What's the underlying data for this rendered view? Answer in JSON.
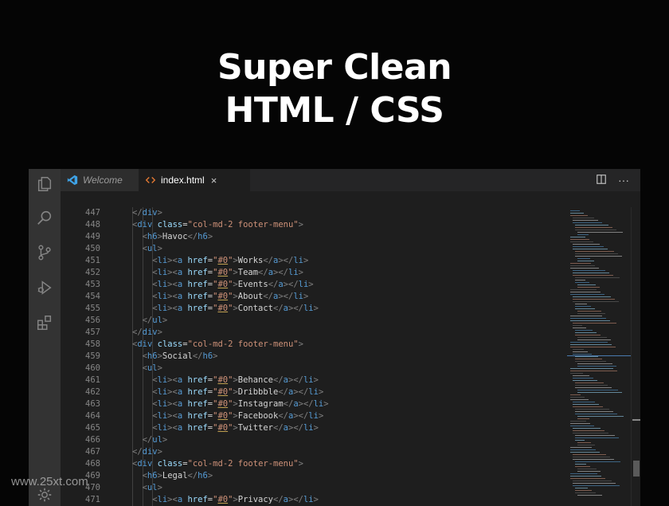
{
  "headline": {
    "line1": "Super Clean",
    "line2": "HTML / CSS"
  },
  "tabs": [
    {
      "label": "Welcome",
      "icon": "vscode-logo-icon",
      "active": false
    },
    {
      "label": "index.html",
      "icon": "html-file-icon",
      "active": true,
      "close": "×"
    }
  ],
  "tab_actions": {
    "split": "split-editor-icon",
    "more": "···"
  },
  "activity_bar": [
    "explorer-icon",
    "search-icon",
    "source-control-icon",
    "run-debug-icon",
    "extensions-icon",
    "settings-gear-icon"
  ],
  "line_numbers": [
    "447",
    "448",
    "449",
    "450",
    "451",
    "452",
    "453",
    "454",
    "455",
    "456",
    "457",
    "458",
    "459",
    "460",
    "461",
    "462",
    "463",
    "464",
    "465",
    "466",
    "467",
    "468",
    "469",
    "470",
    "471"
  ],
  "code_lines": [
    {
      "indent": 2,
      "tokens": [
        [
          "punct",
          "</"
        ],
        [
          "tag",
          "div"
        ],
        [
          "punct",
          ">"
        ]
      ]
    },
    {
      "indent": 2,
      "tokens": [
        [
          "punct",
          "<"
        ],
        [
          "tag",
          "div"
        ],
        [
          "txt",
          " "
        ],
        [
          "attr",
          "class"
        ],
        [
          "txt",
          "="
        ],
        [
          "str",
          "\"col-md-2 footer-menu\""
        ],
        [
          "punct",
          ">"
        ]
      ]
    },
    {
      "indent": 3,
      "tokens": [
        [
          "punct",
          "<"
        ],
        [
          "tag",
          "h6"
        ],
        [
          "punct",
          ">"
        ],
        [
          "txt",
          "Havoc"
        ],
        [
          "punct",
          "</"
        ],
        [
          "tag",
          "h6"
        ],
        [
          "punct",
          ">"
        ]
      ]
    },
    {
      "indent": 3,
      "tokens": [
        [
          "punct",
          "<"
        ],
        [
          "tag",
          "ul"
        ],
        [
          "punct",
          ">"
        ]
      ]
    },
    {
      "indent": 4,
      "tokens": [
        [
          "punct",
          "<"
        ],
        [
          "tag",
          "li"
        ],
        [
          "punct",
          "><"
        ],
        [
          "tag",
          "a"
        ],
        [
          "txt",
          " "
        ],
        [
          "attr",
          "href"
        ],
        [
          "txt",
          "="
        ],
        [
          "str",
          "\""
        ],
        [
          "anchor",
          "#0"
        ],
        [
          "str",
          "\""
        ],
        [
          "punct",
          ">"
        ],
        [
          "txt",
          "Works"
        ],
        [
          "punct",
          "</"
        ],
        [
          "tag",
          "a"
        ],
        [
          "punct",
          "></"
        ],
        [
          "tag",
          "li"
        ],
        [
          "punct",
          ">"
        ]
      ]
    },
    {
      "indent": 4,
      "tokens": [
        [
          "punct",
          "<"
        ],
        [
          "tag",
          "li"
        ],
        [
          "punct",
          "><"
        ],
        [
          "tag",
          "a"
        ],
        [
          "txt",
          " "
        ],
        [
          "attr",
          "href"
        ],
        [
          "txt",
          "="
        ],
        [
          "str",
          "\""
        ],
        [
          "anchor",
          "#0"
        ],
        [
          "str",
          "\""
        ],
        [
          "punct",
          ">"
        ],
        [
          "txt",
          "Team"
        ],
        [
          "punct",
          "</"
        ],
        [
          "tag",
          "a"
        ],
        [
          "punct",
          "></"
        ],
        [
          "tag",
          "li"
        ],
        [
          "punct",
          ">"
        ]
      ]
    },
    {
      "indent": 4,
      "tokens": [
        [
          "punct",
          "<"
        ],
        [
          "tag",
          "li"
        ],
        [
          "punct",
          "><"
        ],
        [
          "tag",
          "a"
        ],
        [
          "txt",
          " "
        ],
        [
          "attr",
          "href"
        ],
        [
          "txt",
          "="
        ],
        [
          "str",
          "\""
        ],
        [
          "anchor",
          "#0"
        ],
        [
          "str",
          "\""
        ],
        [
          "punct",
          ">"
        ],
        [
          "txt",
          "Events"
        ],
        [
          "punct",
          "</"
        ],
        [
          "tag",
          "a"
        ],
        [
          "punct",
          "></"
        ],
        [
          "tag",
          "li"
        ],
        [
          "punct",
          ">"
        ]
      ]
    },
    {
      "indent": 4,
      "tokens": [
        [
          "punct",
          "<"
        ],
        [
          "tag",
          "li"
        ],
        [
          "punct",
          "><"
        ],
        [
          "tag",
          "a"
        ],
        [
          "txt",
          " "
        ],
        [
          "attr",
          "href"
        ],
        [
          "txt",
          "="
        ],
        [
          "str",
          "\""
        ],
        [
          "anchor",
          "#0"
        ],
        [
          "str",
          "\""
        ],
        [
          "punct",
          ">"
        ],
        [
          "txt",
          "About"
        ],
        [
          "punct",
          "</"
        ],
        [
          "tag",
          "a"
        ],
        [
          "punct",
          "></"
        ],
        [
          "tag",
          "li"
        ],
        [
          "punct",
          ">"
        ]
      ]
    },
    {
      "indent": 4,
      "tokens": [
        [
          "punct",
          "<"
        ],
        [
          "tag",
          "li"
        ],
        [
          "punct",
          "><"
        ],
        [
          "tag",
          "a"
        ],
        [
          "txt",
          " "
        ],
        [
          "attr",
          "href"
        ],
        [
          "txt",
          "="
        ],
        [
          "str",
          "\""
        ],
        [
          "anchor",
          "#0"
        ],
        [
          "str",
          "\""
        ],
        [
          "punct",
          ">"
        ],
        [
          "txt",
          "Contact"
        ],
        [
          "punct",
          "</"
        ],
        [
          "tag",
          "a"
        ],
        [
          "punct",
          "></"
        ],
        [
          "tag",
          "li"
        ],
        [
          "punct",
          ">"
        ]
      ]
    },
    {
      "indent": 3,
      "tokens": [
        [
          "punct",
          "</"
        ],
        [
          "tag",
          "ul"
        ],
        [
          "punct",
          ">"
        ]
      ]
    },
    {
      "indent": 2,
      "tokens": [
        [
          "punct",
          "</"
        ],
        [
          "tag",
          "div"
        ],
        [
          "punct",
          ">"
        ]
      ]
    },
    {
      "indent": 2,
      "tokens": [
        [
          "punct",
          "<"
        ],
        [
          "tag",
          "div"
        ],
        [
          "txt",
          " "
        ],
        [
          "attr",
          "class"
        ],
        [
          "txt",
          "="
        ],
        [
          "str",
          "\"col-md-2 footer-menu\""
        ],
        [
          "punct",
          ">"
        ]
      ]
    },
    {
      "indent": 3,
      "tokens": [
        [
          "punct",
          "<"
        ],
        [
          "tag",
          "h6"
        ],
        [
          "punct",
          ">"
        ],
        [
          "txt",
          "Social"
        ],
        [
          "punct",
          "</"
        ],
        [
          "tag",
          "h6"
        ],
        [
          "punct",
          ">"
        ]
      ]
    },
    {
      "indent": 3,
      "tokens": [
        [
          "punct",
          "<"
        ],
        [
          "tag",
          "ul"
        ],
        [
          "punct",
          ">"
        ]
      ]
    },
    {
      "indent": 4,
      "tokens": [
        [
          "punct",
          "<"
        ],
        [
          "tag",
          "li"
        ],
        [
          "punct",
          "><"
        ],
        [
          "tag",
          "a"
        ],
        [
          "txt",
          " "
        ],
        [
          "attr",
          "href"
        ],
        [
          "txt",
          "="
        ],
        [
          "str",
          "\""
        ],
        [
          "anchor",
          "#0"
        ],
        [
          "str",
          "\""
        ],
        [
          "punct",
          ">"
        ],
        [
          "txt",
          "Behance"
        ],
        [
          "punct",
          "</"
        ],
        [
          "tag",
          "a"
        ],
        [
          "punct",
          "></"
        ],
        [
          "tag",
          "li"
        ],
        [
          "punct",
          ">"
        ]
      ]
    },
    {
      "indent": 4,
      "tokens": [
        [
          "punct",
          "<"
        ],
        [
          "tag",
          "li"
        ],
        [
          "punct",
          "><"
        ],
        [
          "tag",
          "a"
        ],
        [
          "txt",
          " "
        ],
        [
          "attr",
          "href"
        ],
        [
          "txt",
          "="
        ],
        [
          "str",
          "\""
        ],
        [
          "anchor",
          "#0"
        ],
        [
          "str",
          "\""
        ],
        [
          "punct",
          ">"
        ],
        [
          "txt",
          "Dribbble"
        ],
        [
          "punct",
          "</"
        ],
        [
          "tag",
          "a"
        ],
        [
          "punct",
          "></"
        ],
        [
          "tag",
          "li"
        ],
        [
          "punct",
          ">"
        ]
      ]
    },
    {
      "indent": 4,
      "tokens": [
        [
          "punct",
          "<"
        ],
        [
          "tag",
          "li"
        ],
        [
          "punct",
          "><"
        ],
        [
          "tag",
          "a"
        ],
        [
          "txt",
          " "
        ],
        [
          "attr",
          "href"
        ],
        [
          "txt",
          "="
        ],
        [
          "str",
          "\""
        ],
        [
          "anchor",
          "#0"
        ],
        [
          "str",
          "\""
        ],
        [
          "punct",
          ">"
        ],
        [
          "txt",
          "Instagram"
        ],
        [
          "punct",
          "</"
        ],
        [
          "tag",
          "a"
        ],
        [
          "punct",
          "></"
        ],
        [
          "tag",
          "li"
        ],
        [
          "punct",
          ">"
        ]
      ]
    },
    {
      "indent": 4,
      "tokens": [
        [
          "punct",
          "<"
        ],
        [
          "tag",
          "li"
        ],
        [
          "punct",
          "><"
        ],
        [
          "tag",
          "a"
        ],
        [
          "txt",
          " "
        ],
        [
          "attr",
          "href"
        ],
        [
          "txt",
          "="
        ],
        [
          "str",
          "\""
        ],
        [
          "anchor",
          "#0"
        ],
        [
          "str",
          "\""
        ],
        [
          "punct",
          ">"
        ],
        [
          "txt",
          "Facebook"
        ],
        [
          "punct",
          "</"
        ],
        [
          "tag",
          "a"
        ],
        [
          "punct",
          "></"
        ],
        [
          "tag",
          "li"
        ],
        [
          "punct",
          ">"
        ]
      ]
    },
    {
      "indent": 4,
      "tokens": [
        [
          "punct",
          "<"
        ],
        [
          "tag",
          "li"
        ],
        [
          "punct",
          "><"
        ],
        [
          "tag",
          "a"
        ],
        [
          "txt",
          " "
        ],
        [
          "attr",
          "href"
        ],
        [
          "txt",
          "="
        ],
        [
          "str",
          "\""
        ],
        [
          "anchor",
          "#0"
        ],
        [
          "str",
          "\""
        ],
        [
          "punct",
          ">"
        ],
        [
          "txt",
          "Twitter"
        ],
        [
          "punct",
          "</"
        ],
        [
          "tag",
          "a"
        ],
        [
          "punct",
          "></"
        ],
        [
          "tag",
          "li"
        ],
        [
          "punct",
          ">"
        ]
      ]
    },
    {
      "indent": 3,
      "tokens": [
        [
          "punct",
          "</"
        ],
        [
          "tag",
          "ul"
        ],
        [
          "punct",
          ">"
        ]
      ]
    },
    {
      "indent": 2,
      "tokens": [
        [
          "punct",
          "</"
        ],
        [
          "tag",
          "div"
        ],
        [
          "punct",
          ">"
        ]
      ]
    },
    {
      "indent": 2,
      "tokens": [
        [
          "punct",
          "<"
        ],
        [
          "tag",
          "div"
        ],
        [
          "txt",
          " "
        ],
        [
          "attr",
          "class"
        ],
        [
          "txt",
          "="
        ],
        [
          "str",
          "\"col-md-2 footer-menu\""
        ],
        [
          "punct",
          ">"
        ]
      ]
    },
    {
      "indent": 3,
      "tokens": [
        [
          "punct",
          "<"
        ],
        [
          "tag",
          "h6"
        ],
        [
          "punct",
          ">"
        ],
        [
          "txt",
          "Legal"
        ],
        [
          "punct",
          "</"
        ],
        [
          "tag",
          "h6"
        ],
        [
          "punct",
          ">"
        ]
      ]
    },
    {
      "indent": 3,
      "tokens": [
        [
          "punct",
          "<"
        ],
        [
          "tag",
          "ul"
        ],
        [
          "punct",
          ">"
        ]
      ]
    },
    {
      "indent": 4,
      "tokens": [
        [
          "punct",
          "<"
        ],
        [
          "tag",
          "li"
        ],
        [
          "punct",
          "><"
        ],
        [
          "tag",
          "a"
        ],
        [
          "txt",
          " "
        ],
        [
          "attr",
          "href"
        ],
        [
          "txt",
          "="
        ],
        [
          "str",
          "\""
        ],
        [
          "anchor",
          "#0"
        ],
        [
          "str",
          "\""
        ],
        [
          "punct",
          ">"
        ],
        [
          "txt",
          "Privacy"
        ],
        [
          "punct",
          "</"
        ],
        [
          "tag",
          "a"
        ],
        [
          "punct",
          "></"
        ],
        [
          "tag",
          "li"
        ],
        [
          "punct",
          ">"
        ]
      ]
    }
  ],
  "watermark": "www.25xt.com",
  "colors": {
    "background": "#050505",
    "editor": "#1e1e1e",
    "activity_bar": "#333333",
    "tag": "#569cd6",
    "attribute": "#9cdcfe",
    "string": "#ce9178",
    "text": "#d4d4d4",
    "line_number": "#858585",
    "html_icon": "#e37933",
    "vscode_icon": "#3ea2e6"
  }
}
